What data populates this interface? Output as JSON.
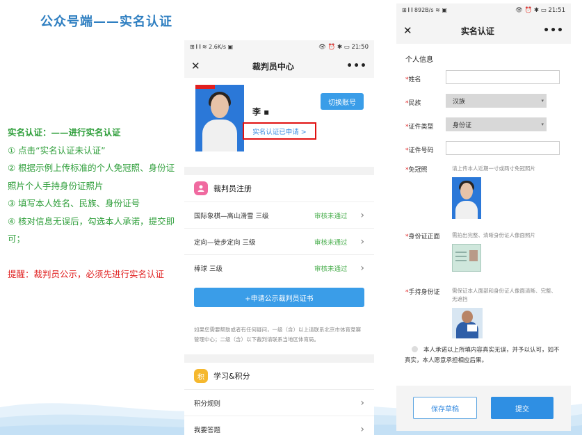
{
  "slide": {
    "title": "公众号端——实名认证",
    "notes": {
      "heading": "实名认证：——进行实名认证",
      "steps": [
        "① 点击“实名认证未认证”",
        "② 根据示例上传标准的个人免冠照、身份证照片个人手持身份证照片",
        "③ 填写本人姓名、民族、身份证号",
        "④ 核对信息无误后，勾选本人承诺，提交即可；"
      ],
      "reminder": "提醒：裁判员公示，必须先进行实名认证"
    }
  },
  "phone1": {
    "status": {
      "left": "⊞ 𝄃 𝄃 ≋ 2.6K/s ▣",
      "right": "👁 ⏰ ✱ ▭ 21:50"
    },
    "nav": {
      "close": "✕",
      "title": "裁判员中心",
      "more": "•••"
    },
    "profile": {
      "name": "李 ▪",
      "switch_label": "切换账号",
      "cert_label": "实名认证已申请 >"
    },
    "register": {
      "title": "裁判员注册",
      "rows": [
        {
          "label": "国际象棋—高山滑雪  三级",
          "status": "审核未通过"
        },
        {
          "label": "定向—徒步定向  三级",
          "status": "审核未通过"
        },
        {
          "label": "棒球  三级",
          "status": "审核未通过"
        }
      ],
      "apply_label": "+申请公示裁判员证书",
      "help": "如果您需要帮助或者有任何疑问，一级（含）以上请联系北京市体育竞赛管理中心；二级（含）以下裁判请联系当地区体育局。"
    },
    "study": {
      "title": "学习&积分",
      "icon": "积",
      "rows": [
        "积分规则",
        "我要答题"
      ]
    }
  },
  "phone2": {
    "status": {
      "left": "⊞ 𝄃 𝄃 892B/s ≋ ▣",
      "right": "👁 ⏰ ✱ ▭ 21:51"
    },
    "nav": {
      "close": "✕",
      "title": "实名认证",
      "more": "•••"
    },
    "form": {
      "section": "个人信息",
      "name_label": "姓名",
      "ethnic_label": "民族",
      "ethnic_value": "汉族",
      "idtype_label": "证件类型",
      "idtype_value": "身份证",
      "idno_label": "证件号码",
      "photo_label": "免冠照",
      "photo_hint": "请上传本人近期一寸或两寸免冠照片",
      "front_label": "身份证正面",
      "front_hint": "需拍出完整、清晰身份证人像面照片",
      "hand_label": "手持身份证",
      "hand_hint": "需保证本人面部和身份证人像面清晰、完整、无遮挡",
      "promise": "本人承诺以上所填内容真实无误，并予以认可，如不真实，本人愿意承担相应后果。"
    },
    "actions": {
      "save_label": "保存草稿",
      "submit_label": "提交"
    }
  }
}
